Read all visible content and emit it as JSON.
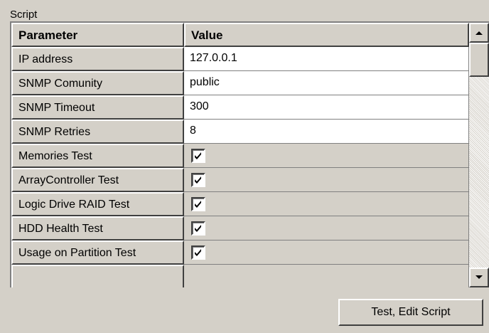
{
  "group": {
    "label": "Script"
  },
  "grid": {
    "headers": {
      "parameter": "Parameter",
      "value": "Value"
    },
    "rows": [
      {
        "parameter": "IP address",
        "value": "127.0.0.1"
      },
      {
        "parameter": "SNMP Comunity",
        "value": "public"
      },
      {
        "parameter": "SNMP Timeout",
        "value": "300"
      },
      {
        "parameter": "SNMP Retries",
        "value": "8"
      },
      {
        "parameter": "Memories Test",
        "checked": true
      },
      {
        "parameter": "ArrayController Test",
        "checked": true
      },
      {
        "parameter": "Logic Drive RAID Test",
        "checked": true
      },
      {
        "parameter": "HDD Health Test",
        "checked": true
      },
      {
        "parameter": "Usage on Partition Test",
        "checked": true
      }
    ]
  },
  "buttons": {
    "test_edit": "Test, Edit Script"
  },
  "icons": {
    "scroll_up": "arrow-up-icon",
    "scroll_down": "arrow-down-icon",
    "check": "checkmark-icon"
  }
}
